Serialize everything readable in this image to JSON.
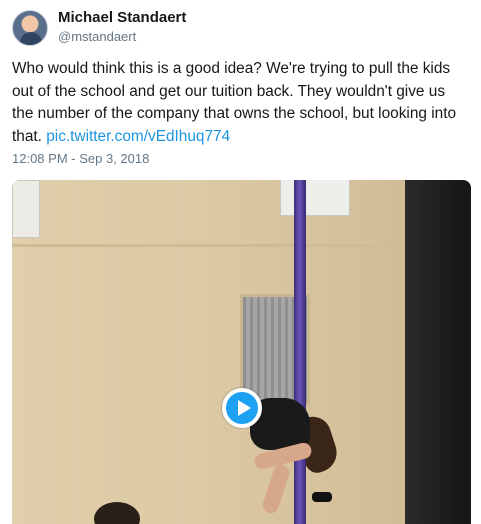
{
  "tweet": {
    "author": {
      "display_name": "Michael Standaert",
      "handle": "@mstandaert"
    },
    "text": "Who would think this is a good idea? We're trying to pull the kids out of the school and get our tuition back. They wouldn't give us the number of the company that owns the school, but looking into that.",
    "link": "pic.twitter.com/vEdIhuq774",
    "timestamp": "12:08 PM - Sep 3, 2018",
    "media": {
      "type": "video",
      "icon": "play-icon"
    }
  },
  "colors": {
    "link": "#1b95e0",
    "secondary_text": "#657786",
    "play_button": "#1da1f2"
  }
}
